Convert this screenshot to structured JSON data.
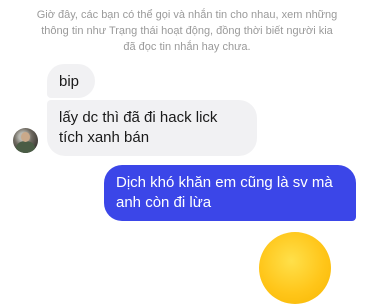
{
  "notice": {
    "line1": "Giờ đây, các bạn có thể gọi và nhắn tin cho nhau, xem những",
    "line2": "thông tin như Trạng thái hoạt động, đồng thời biết người kia",
    "line3": "đã đọc tin nhắn hay chưa."
  },
  "messages": {
    "incoming": [
      {
        "text": "bip"
      },
      {
        "text": "lấy dc thì đã đi hack lick tích xanh bán"
      }
    ],
    "outgoing": [
      {
        "text": "Dịch khó khăn em cũng là sv mà anh còn đi lừa"
      }
    ]
  },
  "colors": {
    "incoming_bubble": "#f1f1f3",
    "outgoing_bubble": "#3b46e8",
    "notice_text": "#9a9a9a"
  },
  "icons": {
    "avatar": "contact-avatar",
    "emoji": "smiley-emoji-icon"
  }
}
